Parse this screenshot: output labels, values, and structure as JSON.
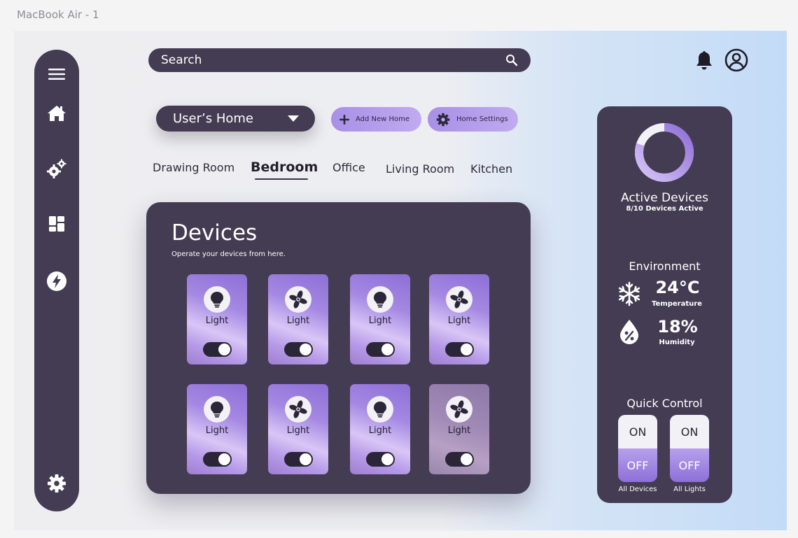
{
  "frame_label": "MacBook Air - 1",
  "search": {
    "placeholder": "Search"
  },
  "sidebar": {
    "items": [
      {
        "icon": "menu-icon"
      },
      {
        "icon": "home-icon"
      },
      {
        "icon": "gears-icon"
      },
      {
        "icon": "dashboard-icon"
      },
      {
        "icon": "energy-icon"
      },
      {
        "icon": "settings-icon"
      }
    ]
  },
  "header": {
    "icons": [
      "bell-icon",
      "user-icon"
    ]
  },
  "home_select": {
    "value": "User’s Home"
  },
  "actions": {
    "add_home": "Add New Home",
    "home_settings": "Home Settings"
  },
  "rooms": {
    "tabs": [
      "Drawing Room",
      "Bedroom",
      "Office",
      "Living Room",
      "Kitchen"
    ],
    "active": "Bedroom"
  },
  "devices": {
    "title": "Devices",
    "subtitle": "Operate your devices from here.",
    "cards": [
      {
        "label": "Light",
        "icon": "bulb-icon",
        "on": true
      },
      {
        "label": "Light",
        "icon": "fan-icon",
        "on": true
      },
      {
        "label": "Light",
        "icon": "bulb-icon",
        "on": true
      },
      {
        "label": "Light",
        "icon": "fan-icon",
        "on": true
      },
      {
        "label": "Light",
        "icon": "bulb-icon",
        "on": true
      },
      {
        "label": "Light",
        "icon": "fan-icon",
        "on": true
      },
      {
        "label": "Light",
        "icon": "bulb-icon",
        "on": true
      },
      {
        "label": "Light",
        "icon": "fan-icon",
        "on": true
      }
    ]
  },
  "active_devices": {
    "title": "Active Devices",
    "subtitle": "8/10 Devices Active",
    "active": 8,
    "total": 10
  },
  "environment": {
    "title": "Environment",
    "temperature_value": "24°C",
    "temperature_label": "Temperature",
    "humidity_value": "18%",
    "humidity_label": "Humidity"
  },
  "quick_control": {
    "title": "Quick Control",
    "groups": [
      {
        "on_label": "ON",
        "off_label": "OFF",
        "label": "All Devices"
      },
      {
        "on_label": "ON",
        "off_label": "OFF",
        "label": "All Lights"
      }
    ]
  },
  "colors": {
    "panel": "#433c52",
    "accent": "#9b7fe0",
    "accent_light": "#d9c6f6"
  }
}
